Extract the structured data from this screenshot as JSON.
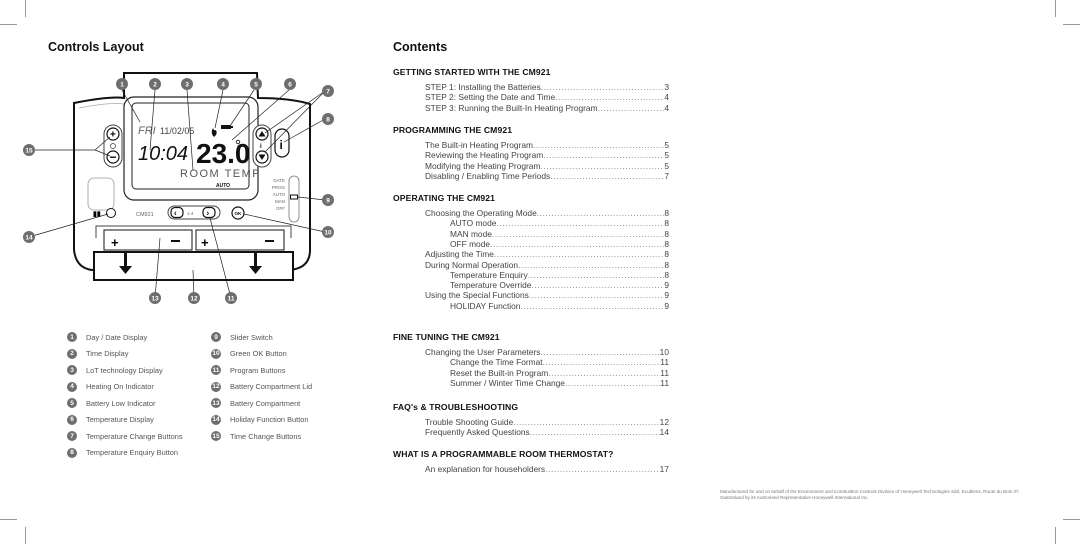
{
  "left_page": {
    "title": "Controls Layout",
    "device": {
      "model_label": "CM921",
      "lcd": {
        "day": "FRI",
        "date": "11/02/05",
        "time": "10:04",
        "temperature": "23.0",
        "mode_text": "ROOM TEMP",
        "mode": "AUTO"
      },
      "program_buttons_label": "1-4",
      "ok_label": "OK",
      "info_label": "i",
      "slider_positions": [
        "DATE",
        "PROG",
        "AUTO",
        "MAN",
        "OFF"
      ],
      "slider_selected": "AUTO"
    },
    "callouts": [
      "1",
      "2",
      "3",
      "4",
      "5",
      "6",
      "7",
      "8",
      "9",
      "10",
      "11",
      "12",
      "13",
      "14",
      "15"
    ],
    "legend_left": [
      {
        "num": "1",
        "label": "Day / Date Display"
      },
      {
        "num": "2",
        "label": "Time Display"
      },
      {
        "num": "3",
        "label": "LoT technology Display"
      },
      {
        "num": "4",
        "label": "Heating On Indicator"
      },
      {
        "num": "5",
        "label": "Battery Low Indicator"
      },
      {
        "num": "6",
        "label": "Temperature Display"
      },
      {
        "num": "7",
        "label": "Temperature Change Buttons"
      },
      {
        "num": "8",
        "label": "Temperature Enquiry Button"
      }
    ],
    "legend_right": [
      {
        "num": "9",
        "label": "Slider Switch"
      },
      {
        "num": "10",
        "label": "Green OK Button"
      },
      {
        "num": "11",
        "label": "Program Buttons"
      },
      {
        "num": "12",
        "label": "Battery Compartment Lid"
      },
      {
        "num": "13",
        "label": "Battery Compartment"
      },
      {
        "num": "14",
        "label": "Holiday Function Button"
      },
      {
        "num": "15",
        "label": "Time Change Buttons"
      }
    ]
  },
  "right_page": {
    "title": "Contents",
    "sections": [
      {
        "heading": "GETTING STARTED WITH THE CM921",
        "items": [
          {
            "text": "STEP 1: Installing the Batteries",
            "page": "3",
            "indent": 0
          },
          {
            "text": "STEP 2: Setting the Date and Time",
            "page": "4",
            "indent": 0
          },
          {
            "text": "STEP 3: Running the Built-In Heating Program ",
            "page": "4",
            "indent": 0
          }
        ]
      },
      {
        "heading": "PROGRAMMING THE CM921",
        "items": [
          {
            "text": "The Built-in Heating Program",
            "page": "5",
            "indent": 0
          },
          {
            "text": "Reviewing the Heating Program",
            "page": "5",
            "indent": 0
          },
          {
            "text": "Modifying the Heating Program",
            "page": "5",
            "indent": 0
          },
          {
            "text": "Disabling / Enabling Time Periods ",
            "page": "7",
            "indent": 0
          }
        ]
      },
      {
        "heading": "OPERATING THE CM921",
        "items": [
          {
            "text": "Choosing the Operating Mode ",
            "page": "8",
            "indent": 0
          },
          {
            "text": "AUTO mode",
            "page": "8",
            "indent": 1
          },
          {
            "text": "MAN mode ",
            "page": "8",
            "indent": 1
          },
          {
            "text": "OFF mode",
            "page": "8",
            "indent": 1
          },
          {
            "text": "Adjusting the Time",
            "page": "8",
            "indent": 0
          },
          {
            "text": "During Normal Operation",
            "page": "8",
            "indent": 0
          },
          {
            "text": "Temperature Enquiry ",
            "page": "8",
            "indent": 1
          },
          {
            "text": "Temperature Override ",
            "page": "9",
            "indent": 1
          },
          {
            "text": "Using the Special Functions",
            "page": "9",
            "indent": 0
          },
          {
            "text": "HOLIDAY Function ",
            "page": "9",
            "indent": 1
          }
        ]
      },
      {
        "heading": "FINE TUNING THE CM921",
        "items": [
          {
            "text": "Changing the User Parameters ",
            "page": "10",
            "indent": 0
          },
          {
            "text": "Change the Time Format",
            "page": "11",
            "indent": 1
          },
          {
            "text": "Reset the Built-in Program",
            "page": "11",
            "indent": 1
          },
          {
            "text": "Summer / Winter Time Change ",
            "page": "11",
            "indent": 1
          }
        ]
      },
      {
        "heading": "FAQ's & TROUBLESHOOTING",
        "items": [
          {
            "text": "Trouble Shooting Guide",
            "page": "12",
            "indent": 0
          },
          {
            "text": "Frequently Asked Questions",
            "page": "14",
            "indent": 0
          }
        ]
      },
      {
        "heading": "WHAT IS A PROGRAMMABLE ROOM THERMOSTAT?",
        "items": [
          {
            "text": "An explanation for householders",
            "page": "17",
            "indent": 0
          }
        ]
      }
    ],
    "footer": "Manufactured for and on behalf of the Environment and Combustion Controls Division of Honeywell Technologies Sàrl, Ecublens, Route du Bois 37, Switzerland by its Authorised Representative Honeywell International Inc."
  }
}
